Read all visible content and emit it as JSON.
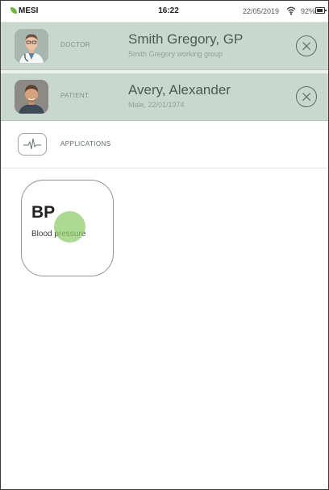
{
  "status_bar": {
    "brand": "MESI",
    "time": "16:22",
    "date": "22/05/2019",
    "battery": "92%",
    "battery_level": 0.92,
    "icons": [
      "wifi-icon",
      "battery-icon"
    ]
  },
  "doctor": {
    "label": "DOCTOR",
    "name": "Smith Gregory, GP",
    "subtitle": "Smith Gregory working group"
  },
  "patient": {
    "label": "PATIENT",
    "name": "Avery, Alexander",
    "subtitle": "Male, 22/01/1974"
  },
  "applications": {
    "label": "APPLICATIONS",
    "icon": "heart-pulse-icon"
  },
  "cards": [
    {
      "title": "BP",
      "subtitle": "Blood pressure"
    }
  ],
  "colors": {
    "accent": "#74b63b",
    "row_background": "#c9d8cf",
    "touch": "#8fcb6a"
  }
}
